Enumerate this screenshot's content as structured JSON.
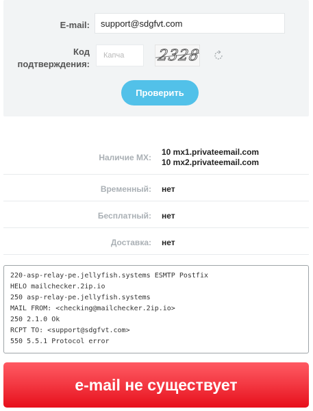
{
  "form": {
    "email_label": "E-mail:",
    "email_value": "support@sdgfvt.com",
    "code_label_line1": "Код",
    "code_label_line2": "подтверждения:",
    "captcha_placeholder": "Капча",
    "captcha_text": "2328",
    "refresh_icon": "refresh-icon",
    "check_button": "Проверить"
  },
  "results": {
    "mx_label": "Наличие MX:",
    "mx_records": [
      "10 mx1.privateemail.com",
      "10 mx2.privateemail.com"
    ],
    "temporary_label": "Временный:",
    "temporary_value": "нет",
    "free_label": "Бесплатный:",
    "free_value": "нет",
    "delivery_label": "Доставка:",
    "delivery_value": "нет"
  },
  "log": [
    "220-asp-relay-pe.jellyfish.systems ESMTP Postfix",
    "HELO mailchecker.2ip.io",
    "250 asp-relay-pe.jellyfish.systems",
    "MAIL FROM: <checking@mailchecker.2ip.io>",
    "250 2.1.0 Ok",
    "RCPT TO: <support@sdgfvt.com>",
    "550 5.5.1 Protocol error"
  ],
  "verdict": "e-mail не существует",
  "colors": {
    "accent": "#52c1e9",
    "error": "#ee2430",
    "panel": "#f2f4f5"
  }
}
